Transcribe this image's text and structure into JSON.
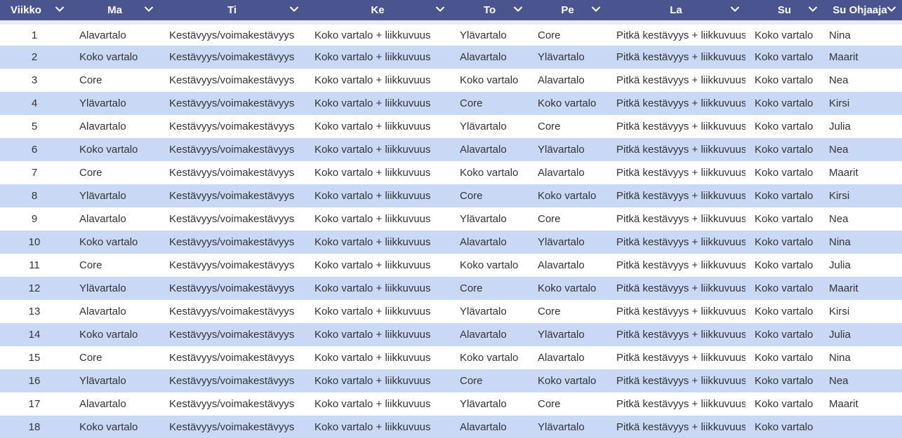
{
  "table": {
    "headers": [
      "Viikko",
      "Ma",
      "Ti",
      "Ke",
      "To",
      "Pe",
      "La",
      "Su",
      "Su Ohjaaja"
    ],
    "rows": [
      [
        "1",
        "Alavartalo",
        "Kestävyys/voimakestävyys",
        "Koko vartalo + liikkuvuus",
        "Ylävartalo",
        "Core",
        "Pitkä kestävyys + liikkuvuus",
        "Koko vartalo",
        "Nina"
      ],
      [
        "2",
        "Koko vartalo",
        "Kestävyys/voimakestävyys",
        "Koko vartalo + liikkuvuus",
        "Alavartalo",
        "Ylävartalo",
        "Pitkä kestävyys + liikkuvuus",
        "Koko vartalo",
        "Maarit"
      ],
      [
        "3",
        "Core",
        "Kestävyys/voimakestävyys",
        "Koko vartalo + liikkuvuus",
        "Koko vartalo",
        "Alavartalo",
        "Pitkä kestävyys + liikkuvuus",
        "Koko vartalo",
        "Nea"
      ],
      [
        "4",
        "Ylävartalo",
        "Kestävyys/voimakestävyys",
        "Koko vartalo + liikkuvuus",
        "Core",
        "Koko vartalo",
        "Pitkä kestävyys + liikkuvuus",
        "Koko vartalo",
        "Kirsi"
      ],
      [
        "5",
        "Alavartalo",
        "Kestävyys/voimakestävyys",
        "Koko vartalo + liikkuvuus",
        "Ylävartalo",
        "Core",
        "Pitkä kestävyys + liikkuvuus",
        "Koko vartalo",
        "Julia"
      ],
      [
        "6",
        "Koko vartalo",
        "Kestävyys/voimakestävyys",
        "Koko vartalo + liikkuvuus",
        "Alavartalo",
        "Ylävartalo",
        "Pitkä kestävyys + liikkuvuus",
        "Koko vartalo",
        "Nea"
      ],
      [
        "7",
        "Core",
        "Kestävyys/voimakestävyys",
        "Koko vartalo + liikkuvuus",
        "Koko vartalo",
        "Alavartalo",
        "Pitkä kestävyys + liikkuvuus",
        "Koko vartalo",
        "Maarit"
      ],
      [
        "8",
        "Ylävartalo",
        "Kestävyys/voimakestävyys",
        "Koko vartalo + liikkuvuus",
        "Core",
        "Koko vartalo",
        "Pitkä kestävyys + liikkuvuus",
        "Koko vartalo",
        "Kirsi"
      ],
      [
        "9",
        "Alavartalo",
        "Kestävyys/voimakestävyys",
        "Koko vartalo + liikkuvuus",
        "Ylävartalo",
        "Core",
        "Pitkä kestävyys + liikkuvuus",
        "Koko vartalo",
        "Nea"
      ],
      [
        "10",
        "Koko vartalo",
        "Kestävyys/voimakestävyys",
        "Koko vartalo + liikkuvuus",
        "Alavartalo",
        "Ylävartalo",
        "Pitkä kestävyys + liikkuvuus",
        "Koko vartalo",
        "Nina"
      ],
      [
        "11",
        "Core",
        "Kestävyys/voimakestävyys",
        "Koko vartalo + liikkuvuus",
        "Koko vartalo",
        "Alavartalo",
        "Pitkä kestävyys + liikkuvuus",
        "Koko vartalo",
        "Julia"
      ],
      [
        "12",
        "Ylävartalo",
        "Kestävyys/voimakestävyys",
        "Koko vartalo + liikkuvuus",
        "Core",
        "Koko vartalo",
        "Pitkä kestävyys + liikkuvuus",
        "Koko vartalo",
        "Maarit"
      ],
      [
        "13",
        "Alavartalo",
        "Kestävyys/voimakestävyys",
        "Koko vartalo + liikkuvuus",
        "Ylävartalo",
        "Core",
        "Pitkä kestävyys + liikkuvuus",
        "Koko vartalo",
        "Kirsi"
      ],
      [
        "14",
        "Koko vartalo",
        "Kestävyys/voimakestävyys",
        "Koko vartalo + liikkuvuus",
        "Alavartalo",
        "Ylävartalo",
        "Pitkä kestävyys + liikkuvuus",
        "Koko vartalo",
        "Julia"
      ],
      [
        "15",
        "Core",
        "Kestävyys/voimakestävyys",
        "Koko vartalo + liikkuvuus",
        "Koko vartalo",
        "Alavartalo",
        "Pitkä kestävyys + liikkuvuus",
        "Koko vartalo",
        "Nina"
      ],
      [
        "16",
        "Ylävartalo",
        "Kestävyys/voimakestävyys",
        "Koko vartalo + liikkuvuus",
        "Core",
        "Koko vartalo",
        "Pitkä kestävyys + liikkuvuus",
        "Koko vartalo",
        "Nea"
      ],
      [
        "17",
        "Alavartalo",
        "Kestävyys/voimakestävyys",
        "Koko vartalo + liikkuvuus",
        "Ylävartalo",
        "Core",
        "Pitkä kestävyys + liikkuvuus",
        "Koko vartalo",
        "Maarit"
      ],
      [
        "18",
        "Koko vartalo",
        "Kestävyys/voimakestävyys",
        "Koko vartalo + liikkuvuus",
        "Alavartalo",
        "Ylävartalo",
        "Pitkä kestävyys + liikkuvuus",
        "Koko vartalo",
        ""
      ]
    ]
  },
  "icons": {
    "sort": "chevron-down-icon"
  },
  "colors": {
    "header_bg": "#4a5590",
    "header_text": "#ffffff",
    "row_alt": "#c9d9f5",
    "row_base": "#ffffff",
    "cell_text": "#333333"
  }
}
